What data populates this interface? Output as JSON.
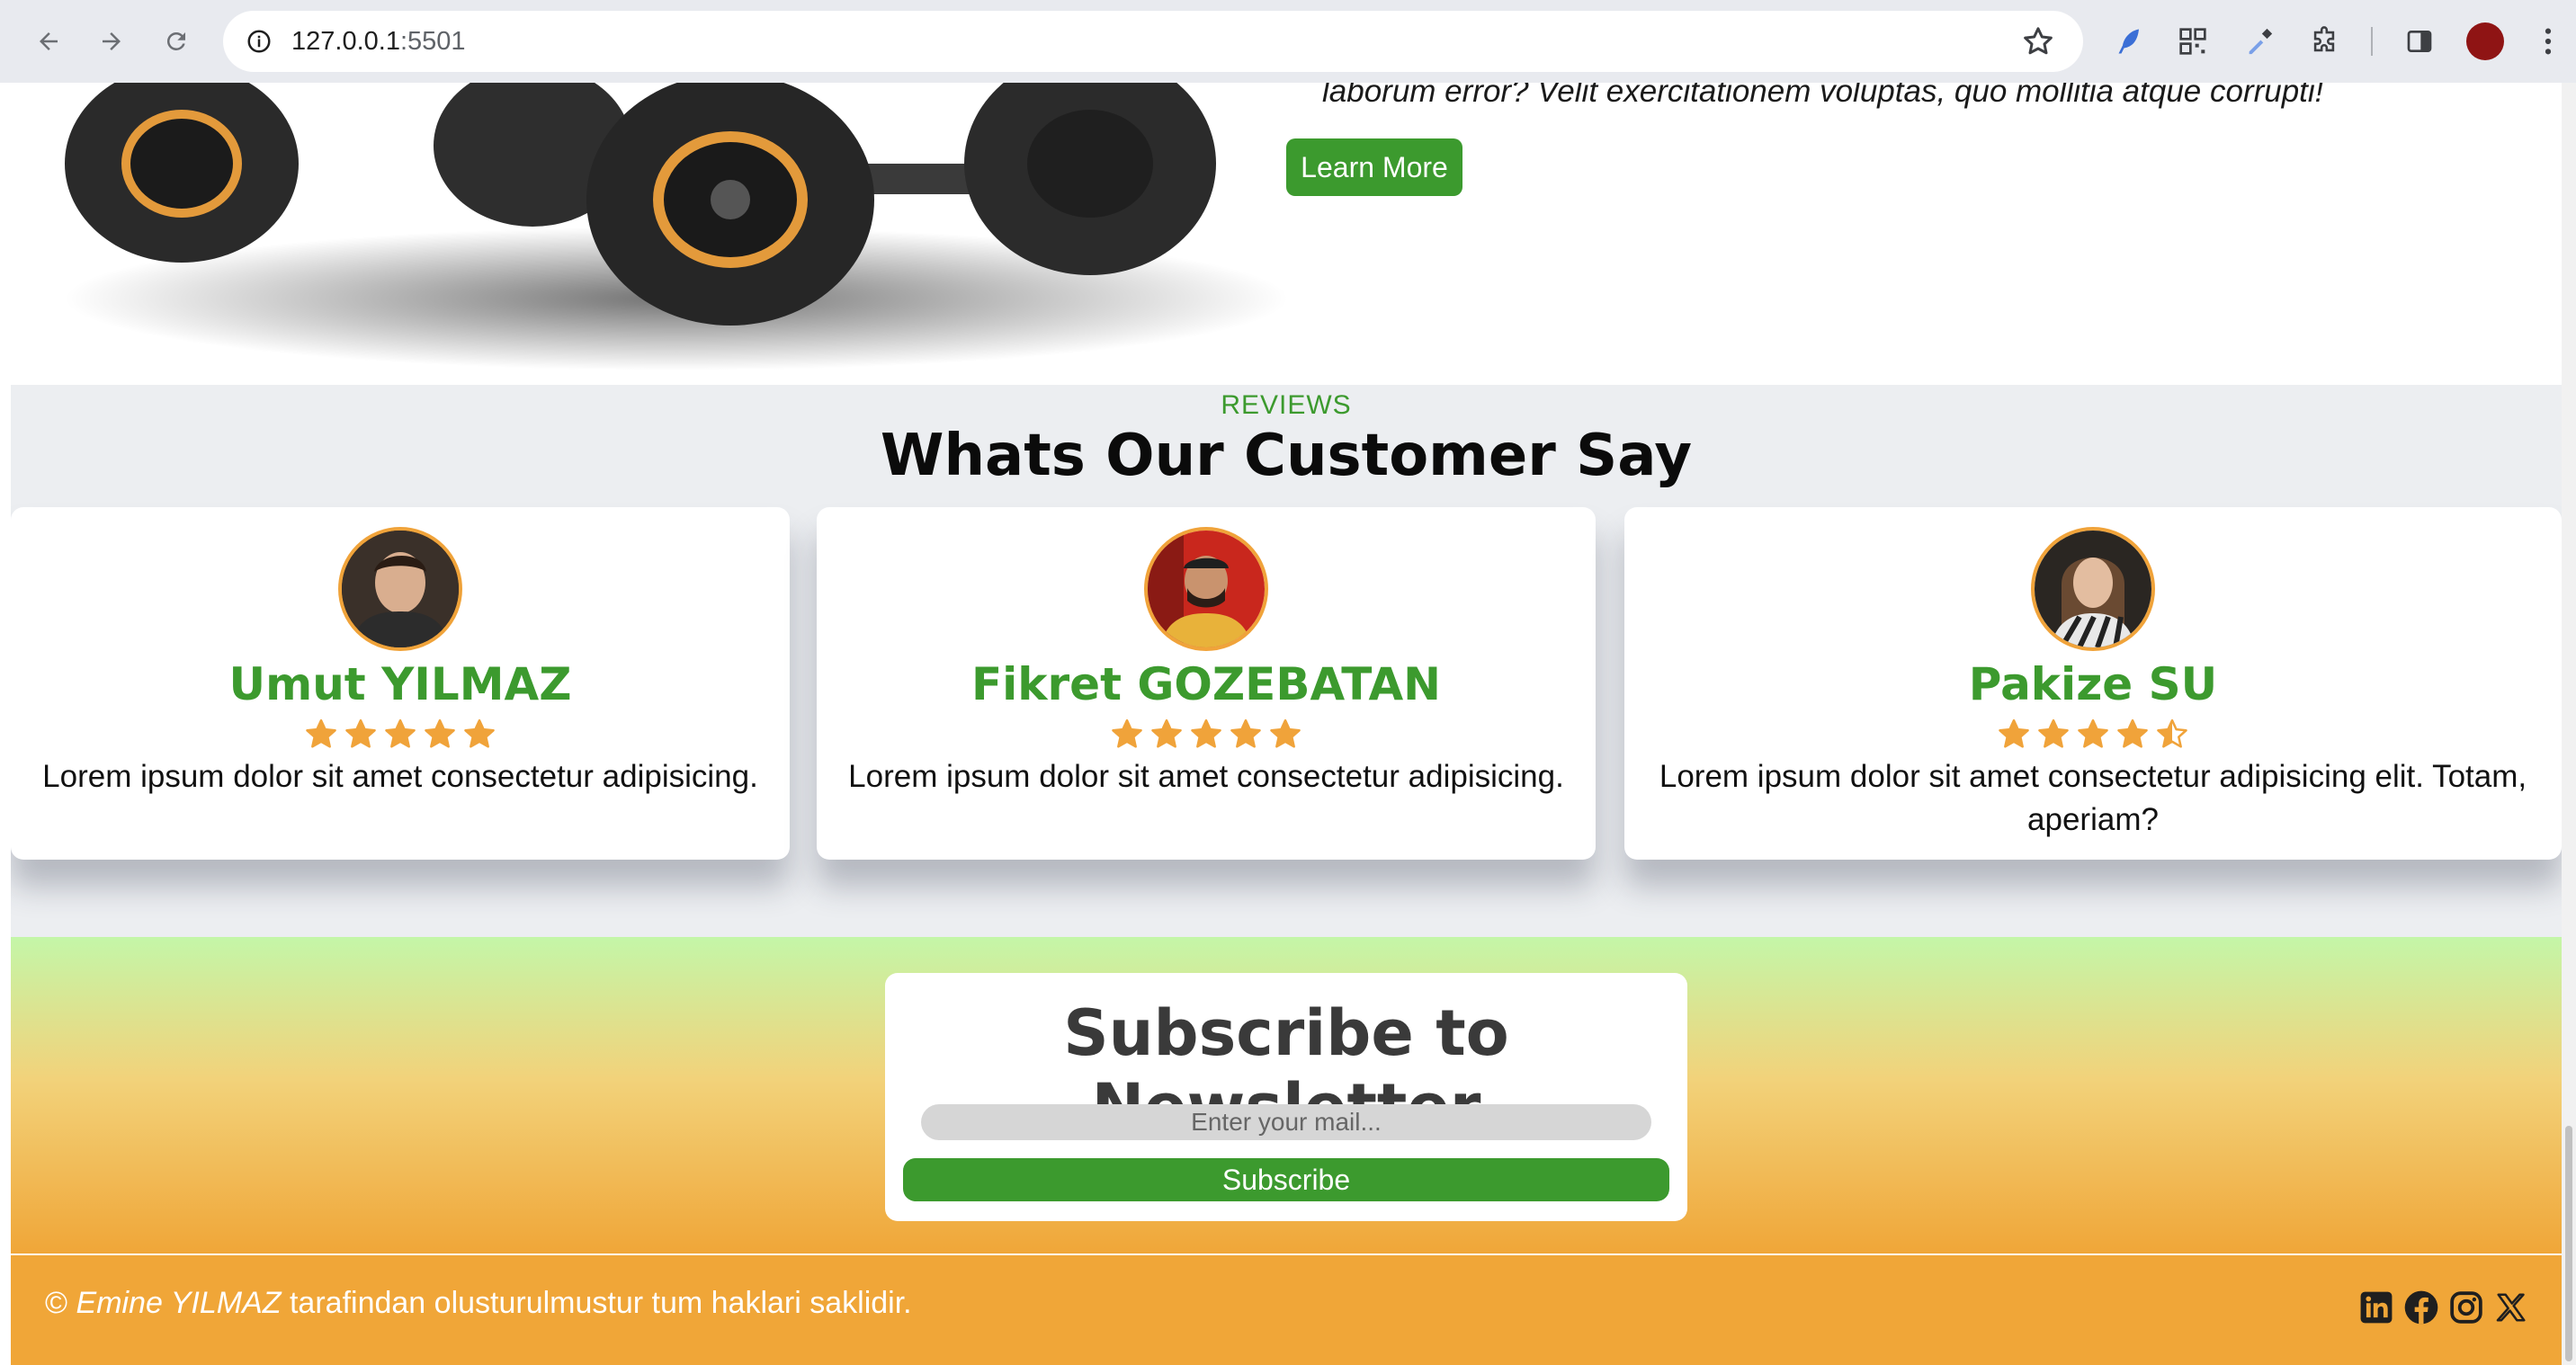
{
  "browser": {
    "url_host": "127.0.0.1",
    "url_port": ":5501"
  },
  "hero": {
    "text_fragment": "laborum error? Velit exercitationem voluptas, quo mollitia atque corrupti!",
    "learn_more_label": "Learn More"
  },
  "reviews": {
    "tag": "REVIEWS",
    "title": "Whats Our Customer Say",
    "cards": [
      {
        "name": "Umut YILMAZ",
        "rating": 5,
        "text": "Lorem ipsum dolor sit amet consectetur adipisicing."
      },
      {
        "name": "Fikret GOZEBATAN",
        "rating": 5,
        "text": "Lorem ipsum dolor sit amet consectetur adipisicing."
      },
      {
        "name": "Pakize SU",
        "rating": 4.5,
        "text": "Lorem ipsum dolor sit amet consectetur adipisicing elit. Totam, aperiam?"
      }
    ]
  },
  "newsletter": {
    "title": "Subscribe to Newsletter",
    "placeholder": "Enter your mail...",
    "button_label": "Subscribe"
  },
  "footer": {
    "copyright": "©",
    "author": "Emine YILMAZ",
    "rest": "tarafindan olusturulmustur tum haklari saklidir.",
    "socials": [
      "linkedin-icon",
      "facebook-icon",
      "instagram-icon",
      "x-icon"
    ]
  },
  "colors": {
    "accent_green": "#3c9a2e",
    "star_orange": "#f0a33a",
    "footer_orange": "#f0a638"
  }
}
